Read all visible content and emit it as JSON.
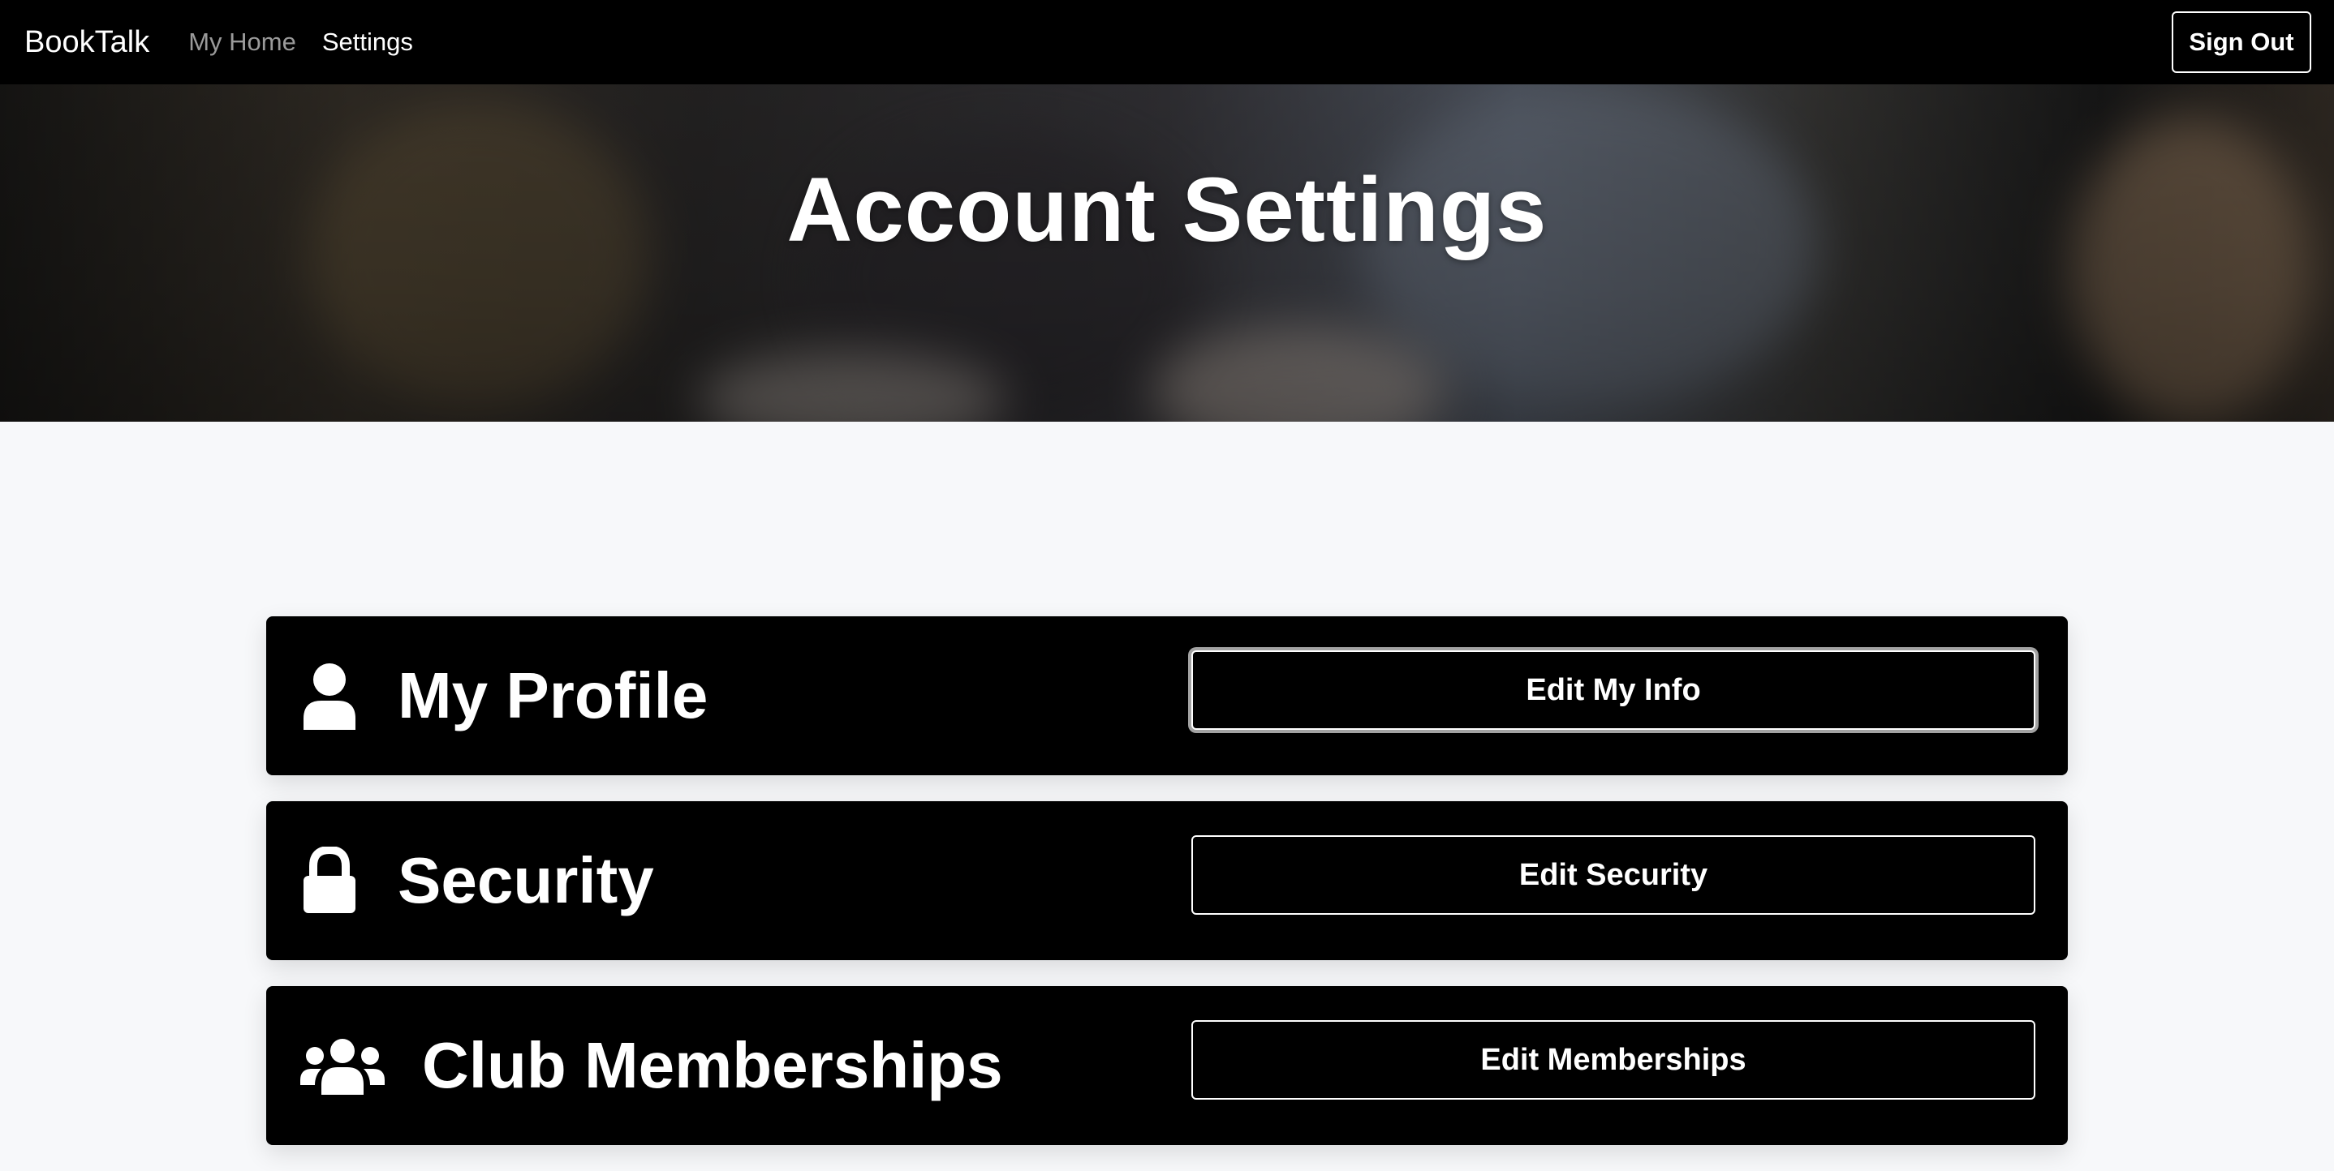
{
  "navbar": {
    "brand": "BookTalk",
    "links": [
      {
        "label": "My Home",
        "state": "inactive"
      },
      {
        "label": "Settings",
        "state": "active"
      }
    ],
    "sign_out": "Sign Out"
  },
  "hero": {
    "title": "Account Settings"
  },
  "cards": [
    {
      "icon": "user-icon",
      "title": "My Profile",
      "button": "Edit My Info"
    },
    {
      "icon": "lock-icon",
      "title": "Security",
      "button": "Edit Security"
    },
    {
      "icon": "users-icon",
      "title": "Club Memberships",
      "button": "Edit Memberships"
    }
  ],
  "colors": {
    "navbar_bg": "#000000",
    "page_bg": "#f7f8fa",
    "card_bg": "#000000",
    "text_light": "#ffffff",
    "nav_muted": "#9a9a9a"
  }
}
